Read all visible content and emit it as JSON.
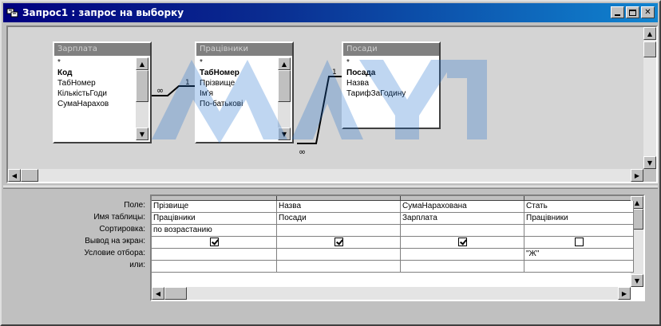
{
  "window": {
    "title": "Запрос1 : запрос на выборку"
  },
  "tables": [
    {
      "title": "Зарплата",
      "fields": [
        {
          "name": "*",
          "key": false
        },
        {
          "name": "Код",
          "key": true
        },
        {
          "name": "ТабНомер",
          "key": false
        },
        {
          "name": "КількістьГоди",
          "key": false
        },
        {
          "name": "СумаНарахов",
          "key": false
        }
      ]
    },
    {
      "title": "Працівники",
      "fields": [
        {
          "name": "*",
          "key": false
        },
        {
          "name": "ТабНомер",
          "key": true
        },
        {
          "name": "Прізвище",
          "key": false
        },
        {
          "name": "Ім'я",
          "key": false
        },
        {
          "name": "По-батькові",
          "key": false
        }
      ]
    },
    {
      "title": "Посади",
      "fields": [
        {
          "name": "*",
          "key": false
        },
        {
          "name": "Посада",
          "key": true
        },
        {
          "name": "Назва",
          "key": false
        },
        {
          "name": "ТарифЗаГодину",
          "key": false
        }
      ]
    }
  ],
  "relations": [
    {
      "from": "Зарплата",
      "to": "Працівники",
      "from_mark": "∞",
      "to_mark": "1"
    },
    {
      "from": "Посади",
      "to": "Працівники",
      "from_mark": "1",
      "to_mark": "∞"
    }
  ],
  "grid": {
    "row_labels": [
      "Поле:",
      "Имя таблицы:",
      "Сортировка:",
      "Вывод на экран:",
      "Условие отбора:",
      "или:"
    ],
    "columns": [
      {
        "field": "Прізвище",
        "table": "Працівники",
        "sort": "по возрастанию",
        "show": true,
        "criteria": ""
      },
      {
        "field": "Назва",
        "table": "Посади",
        "sort": "",
        "show": true,
        "criteria": ""
      },
      {
        "field": "СумаНарахована",
        "table": "Зарплата",
        "sort": "",
        "show": true,
        "criteria": ""
      },
      {
        "field": "Стать",
        "table": "Працівники",
        "sort": "",
        "show": false,
        "criteria": "\"Ж\""
      }
    ]
  },
  "icons": {
    "app": "query-icon",
    "minimize": "minimize-icon",
    "maximize": "maximize-icon",
    "close": "close-icon"
  },
  "colors": {
    "titlebar_start": "#000080",
    "titlebar_end": "#1084d0",
    "face": "#c0c0c0",
    "pane": "#d4d4d4"
  }
}
